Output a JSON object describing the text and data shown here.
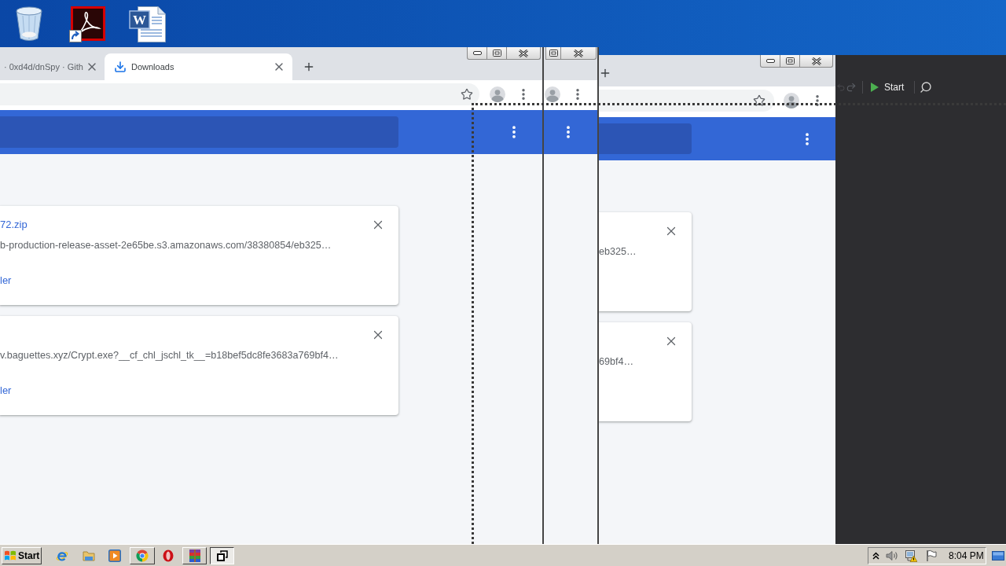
{
  "desktop": {
    "document_badge": "W"
  },
  "downloads_window": {
    "tabs": [
      {
        "title": "· 0xd4d/dnSpy · Gith",
        "selected": false
      },
      {
        "title": "Downloads",
        "selected": true
      }
    ],
    "downloads": [
      {
        "file_name": "72.zip",
        "url": "b-production-release-asset-2e65be.s3.amazonaws.com/38380854/eb325…",
        "action": "ler"
      },
      {
        "url": "v.baguettes.xyz/Crypt.exe?__cf_chl_jschl_tk__=b18bef5dc8fe3683a769bf4…",
        "action": "ler"
      }
    ]
  },
  "rear_window": {
    "downloads": [
      {
        "url": "eb325…"
      },
      {
        "url": "69bf4…"
      }
    ]
  },
  "debugger_toolbar": {
    "start_label": "Start"
  },
  "taskbar": {
    "start_label": "Start",
    "window_buttons": [
      {
        "selected": false
      },
      {
        "selected": false
      },
      {
        "selected": true
      }
    ],
    "clock": "8:04 PM"
  }
}
